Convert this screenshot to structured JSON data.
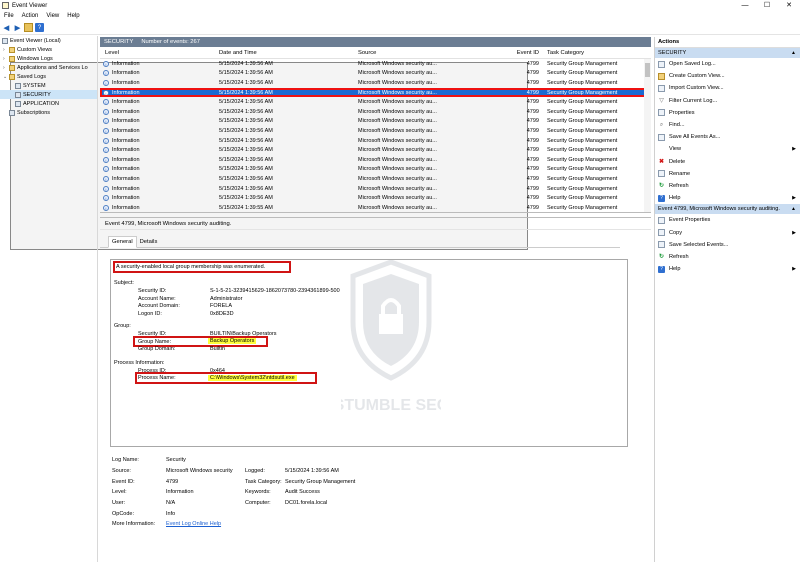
{
  "window": {
    "title": "Event Viewer",
    "minimize": "—",
    "maximize": "☐",
    "close": "✕"
  },
  "menu": [
    "File",
    "Action",
    "View",
    "Help"
  ],
  "tree": {
    "root": "Event Viewer (Local)",
    "items": [
      {
        "label": "Custom Views",
        "level": 1,
        "folder": true
      },
      {
        "label": "Windows Logs",
        "level": 1,
        "folder": true
      },
      {
        "label": "Applications and Services Lo",
        "level": 1,
        "folder": true
      },
      {
        "label": "Saved Logs",
        "level": 1,
        "folder": true,
        "open": true
      },
      {
        "label": "SYSTEM",
        "level": 2
      },
      {
        "label": "SECURITY",
        "level": 2,
        "selected": true
      },
      {
        "label": "APPLICATION",
        "level": 2
      },
      {
        "label": "Subscriptions",
        "level": 1
      }
    ]
  },
  "log": {
    "name": "SECURITY",
    "count": "Number of events: 267"
  },
  "columns": {
    "level": "Level",
    "date": "Date and Time",
    "source": "Source",
    "id": "Event ID",
    "category": "Task Category"
  },
  "rows": [
    {
      "level": "Information",
      "date": "5/15/2024 1:39:56 AM",
      "source": "Microsoft Windows security au...",
      "id": "4799",
      "category": "Security Group Management"
    },
    {
      "level": "Information",
      "date": "5/15/2024 1:39:56 AM",
      "source": "Microsoft Windows security au...",
      "id": "4799",
      "category": "Security Group Management"
    },
    {
      "level": "Information",
      "date": "5/15/2024 1:39:56 AM",
      "source": "Microsoft Windows security au...",
      "id": "4799",
      "category": "Security Group Management"
    },
    {
      "level": "Information",
      "date": "5/15/2024 1:39:56 AM",
      "source": "Microsoft Windows security au...",
      "id": "4799",
      "category": "Security Group Management",
      "selected": true
    },
    {
      "level": "Information",
      "date": "5/15/2024 1:39:56 AM",
      "source": "Microsoft Windows security au...",
      "id": "4799",
      "category": "Security Group Management"
    },
    {
      "level": "Information",
      "date": "5/15/2024 1:39:56 AM",
      "source": "Microsoft Windows security au...",
      "id": "4799",
      "category": "Security Group Management"
    },
    {
      "level": "Information",
      "date": "5/15/2024 1:39:56 AM",
      "source": "Microsoft Windows security au...",
      "id": "4799",
      "category": "Security Group Management"
    },
    {
      "level": "Information",
      "date": "5/15/2024 1:39:56 AM",
      "source": "Microsoft Windows security au...",
      "id": "4799",
      "category": "Security Group Management"
    },
    {
      "level": "Information",
      "date": "5/15/2024 1:39:56 AM",
      "source": "Microsoft Windows security au...",
      "id": "4799",
      "category": "Security Group Management"
    },
    {
      "level": "Information",
      "date": "5/15/2024 1:39:56 AM",
      "source": "Microsoft Windows security au...",
      "id": "4799",
      "category": "Security Group Management"
    },
    {
      "level": "Information",
      "date": "5/15/2024 1:39:56 AM",
      "source": "Microsoft Windows security au...",
      "id": "4799",
      "category": "Security Group Management"
    },
    {
      "level": "Information",
      "date": "5/15/2024 1:39:56 AM",
      "source": "Microsoft Windows security au...",
      "id": "4799",
      "category": "Security Group Management"
    },
    {
      "level": "Information",
      "date": "5/15/2024 1:39:56 AM",
      "source": "Microsoft Windows security au...",
      "id": "4799",
      "category": "Security Group Management"
    },
    {
      "level": "Information",
      "date": "5/15/2024 1:39:56 AM",
      "source": "Microsoft Windows security au...",
      "id": "4799",
      "category": "Security Group Management"
    },
    {
      "level": "Information",
      "date": "5/15/2024 1:39:56 AM",
      "source": "Microsoft Windows security au...",
      "id": "4799",
      "category": "Security Group Management"
    },
    {
      "level": "Information",
      "date": "5/15/2024 1:39:55 AM",
      "source": "Microsoft Windows security au...",
      "id": "4799",
      "category": "Security Group Management"
    }
  ],
  "detail": {
    "header": "Event 4799, Microsoft Windows security auditing.",
    "tabs": [
      "General",
      "Details"
    ],
    "message": "A security-enabled local group membership was enumerated.",
    "subject_label": "Subject:",
    "subject": [
      {
        "k": "Security ID:",
        "v": "S-1-5-21-3239415629-1862073780-2394361899-500"
      },
      {
        "k": "Account Name:",
        "v": "Administrator"
      },
      {
        "k": "Account Domain:",
        "v": "FORELA"
      },
      {
        "k": "Logon ID:",
        "v": "0x8DE3D"
      }
    ],
    "group_label": "Group:",
    "group": [
      {
        "k": "Security ID:",
        "v": "BUILTIN\\Backup Operators"
      },
      {
        "k": "Group Name:",
        "v": "Backup Operators"
      },
      {
        "k": "Group Domain:",
        "v": "Builtin"
      }
    ],
    "process_label": "Process Information:",
    "process": [
      {
        "k": "Process ID:",
        "v": "0x464"
      },
      {
        "k": "Process Name:",
        "v": "C:\\Windows\\System32\\ntdsutil.exe"
      }
    ],
    "props": {
      "log_name_k": "Log Name:",
      "log_name": "Security",
      "source_k": "Source:",
      "source": "Microsoft Windows security",
      "logged_k": "Logged:",
      "logged": "5/15/2024 1:39:56 AM",
      "event_id_k": "Event ID:",
      "event_id": "4799",
      "task_k": "Task Category:",
      "task": "Security Group Management",
      "level_k": "Level:",
      "level": "Information",
      "keywords_k": "Keywords:",
      "keywords": "Audit Success",
      "user_k": "User:",
      "user": "N/A",
      "computer_k": "Computer:",
      "computer": "DC01.forela.local",
      "opcode_k": "OpCode:",
      "opcode": "Info",
      "more_k": "More Information:",
      "more": "Event Log Online Help"
    }
  },
  "actions": {
    "title": "Actions",
    "section1": "SECURITY",
    "items1": [
      {
        "label": "Open Saved Log...",
        "icon": "open-log-icon"
      },
      {
        "label": "Create Custom View...",
        "icon": "custom-view-icon"
      },
      {
        "label": "Import Custom View...",
        "icon": "import-icon"
      },
      {
        "label": "Filter Current Log...",
        "icon": "filter-icon"
      },
      {
        "label": "Properties",
        "icon": "properties-icon"
      },
      {
        "label": "Find...",
        "icon": "find-icon"
      },
      {
        "label": "Save All Events As...",
        "icon": "save-icon"
      },
      {
        "label": "View",
        "icon": "view-icon",
        "arrow": true
      },
      {
        "label": "Delete",
        "icon": "delete-icon"
      },
      {
        "label": "Rename",
        "icon": "rename-icon"
      },
      {
        "label": "Refresh",
        "icon": "refresh-icon"
      },
      {
        "label": "Help",
        "icon": "help-icon",
        "arrow": true
      }
    ],
    "section2": "Event 4799, Microsoft Windows security auditing.",
    "items2": [
      {
        "label": "Event Properties",
        "icon": "event-properties-icon"
      },
      {
        "label": "Copy",
        "icon": "copy-icon",
        "arrow": true
      },
      {
        "label": "Save Selected Events...",
        "icon": "save-icon"
      },
      {
        "label": "Refresh",
        "icon": "refresh-icon"
      },
      {
        "label": "Help",
        "icon": "help-icon",
        "arrow": true
      }
    ]
  },
  "watermark": {
    "text": "STUMBLE SEC"
  },
  "colors": {
    "selection": "#1b6ad2",
    "highlight_border": "#d01414",
    "highlight_fill": "#ffff3d",
    "log_header": "#6b7d93"
  }
}
